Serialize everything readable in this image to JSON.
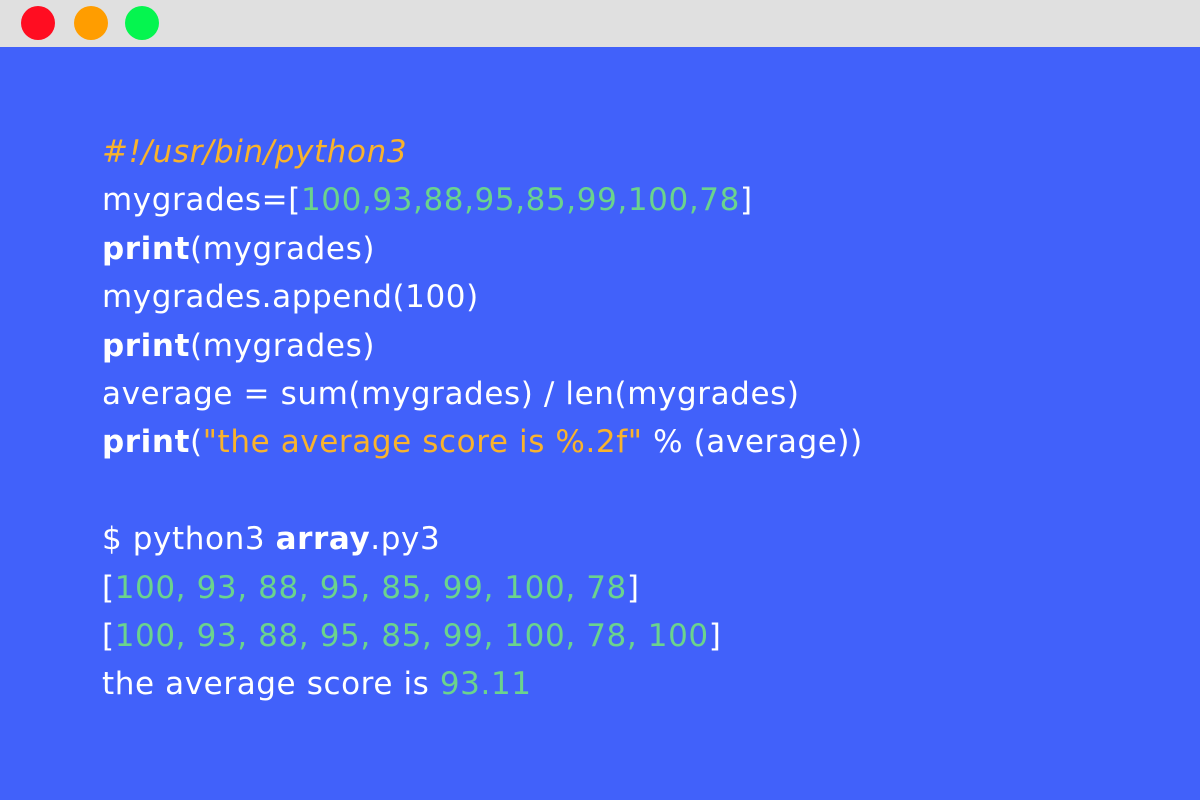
{
  "window": {
    "background_color": "#4161fa",
    "titlebar_color": "#e0e0e0",
    "buttons": [
      {
        "name": "close",
        "color": "#ff0d21"
      },
      {
        "name": "minimize",
        "color": "#ff9d00"
      },
      {
        "name": "maximize",
        "color": "#05f54f"
      }
    ]
  },
  "colors": {
    "default_text": "#ffffff",
    "string": "#f9b32c",
    "number": "#6bd38d"
  },
  "code_lines": [
    {
      "segments": [
        {
          "text": "#!/usr/bin/python3",
          "style": "comment"
        }
      ]
    },
    {
      "segments": [
        {
          "text": "mygrades=[",
          "style": "plain"
        },
        {
          "text": "100,93,88,95,85,99,100,78",
          "style": "number"
        },
        {
          "text": "]",
          "style": "plain"
        }
      ]
    },
    {
      "segments": [
        {
          "text": "print",
          "style": "keyword"
        },
        {
          "text": "(mygrades)",
          "style": "plain"
        }
      ]
    },
    {
      "segments": [
        {
          "text": "mygrades.append(100)",
          "style": "plain"
        }
      ]
    },
    {
      "segments": [
        {
          "text": "print",
          "style": "keyword"
        },
        {
          "text": "(mygrades)",
          "style": "plain"
        }
      ]
    },
    {
      "segments": [
        {
          "text": "average = sum(mygrades) / len(mygrades)",
          "style": "plain"
        }
      ]
    },
    {
      "segments": [
        {
          "text": "print",
          "style": "keyword"
        },
        {
          "text": "(",
          "style": "plain"
        },
        {
          "text": "\"the average score is %.2f\"",
          "style": "string"
        },
        {
          "text": " % (average))",
          "style": "plain"
        }
      ]
    },
    {
      "segments": []
    },
    {
      "segments": [
        {
          "text": "$ python3 ",
          "style": "plain"
        },
        {
          "text": "array",
          "style": "keyword"
        },
        {
          "text": ".py3",
          "style": "plain"
        }
      ]
    },
    {
      "segments": [
        {
          "text": "[",
          "style": "plain"
        },
        {
          "text": "100, 93, 88, 95, 85, 99, 100, 78",
          "style": "number"
        },
        {
          "text": "]",
          "style": "plain"
        }
      ]
    },
    {
      "segments": [
        {
          "text": "[",
          "style": "plain"
        },
        {
          "text": "100, 93, 88, 95, 85, 99, 100, 78, 100",
          "style": "number"
        },
        {
          "text": "]",
          "style": "plain"
        }
      ]
    },
    {
      "segments": [
        {
          "text": "the average score is ",
          "style": "plain"
        },
        {
          "text": "93.11",
          "style": "number"
        }
      ]
    }
  ]
}
